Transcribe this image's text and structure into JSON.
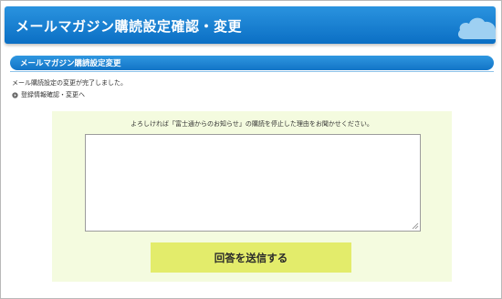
{
  "header": {
    "title": "メールマガジン購読設定確認・変更",
    "background_color": "#1b82d5",
    "icon": "cloud-icon"
  },
  "section": {
    "title": "メールマガジン購読設定変更"
  },
  "main": {
    "done_message": "メール購読設定の変更が完了しました。",
    "back_link_label": "登録情報確認・変更へ",
    "back_link_icon": "arrow-bullet-icon"
  },
  "survey": {
    "question": "よろしければ「富士通からのお知らせ」の購読を停止した理由をお聞かせください。",
    "textarea_value": "",
    "submit_label": "回答を送信する",
    "panel_color": "#f4fbdf",
    "button_color": "#e3ec6b"
  }
}
